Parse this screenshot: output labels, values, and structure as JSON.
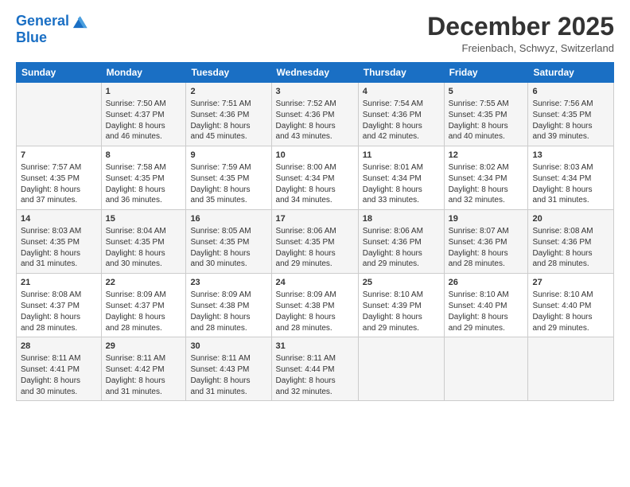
{
  "header": {
    "logo_line1": "General",
    "logo_line2": "Blue",
    "month_title": "December 2025",
    "subtitle": "Freienbach, Schwyz, Switzerland"
  },
  "weekdays": [
    "Sunday",
    "Monday",
    "Tuesday",
    "Wednesday",
    "Thursday",
    "Friday",
    "Saturday"
  ],
  "weeks": [
    [
      {
        "day": "",
        "info": ""
      },
      {
        "day": "1",
        "info": "Sunrise: 7:50 AM\nSunset: 4:37 PM\nDaylight: 8 hours\nand 46 minutes."
      },
      {
        "day": "2",
        "info": "Sunrise: 7:51 AM\nSunset: 4:36 PM\nDaylight: 8 hours\nand 45 minutes."
      },
      {
        "day": "3",
        "info": "Sunrise: 7:52 AM\nSunset: 4:36 PM\nDaylight: 8 hours\nand 43 minutes."
      },
      {
        "day": "4",
        "info": "Sunrise: 7:54 AM\nSunset: 4:36 PM\nDaylight: 8 hours\nand 42 minutes."
      },
      {
        "day": "5",
        "info": "Sunrise: 7:55 AM\nSunset: 4:35 PM\nDaylight: 8 hours\nand 40 minutes."
      },
      {
        "day": "6",
        "info": "Sunrise: 7:56 AM\nSunset: 4:35 PM\nDaylight: 8 hours\nand 39 minutes."
      }
    ],
    [
      {
        "day": "7",
        "info": "Sunrise: 7:57 AM\nSunset: 4:35 PM\nDaylight: 8 hours\nand 37 minutes."
      },
      {
        "day": "8",
        "info": "Sunrise: 7:58 AM\nSunset: 4:35 PM\nDaylight: 8 hours\nand 36 minutes."
      },
      {
        "day": "9",
        "info": "Sunrise: 7:59 AM\nSunset: 4:35 PM\nDaylight: 8 hours\nand 35 minutes."
      },
      {
        "day": "10",
        "info": "Sunrise: 8:00 AM\nSunset: 4:34 PM\nDaylight: 8 hours\nand 34 minutes."
      },
      {
        "day": "11",
        "info": "Sunrise: 8:01 AM\nSunset: 4:34 PM\nDaylight: 8 hours\nand 33 minutes."
      },
      {
        "day": "12",
        "info": "Sunrise: 8:02 AM\nSunset: 4:34 PM\nDaylight: 8 hours\nand 32 minutes."
      },
      {
        "day": "13",
        "info": "Sunrise: 8:03 AM\nSunset: 4:34 PM\nDaylight: 8 hours\nand 31 minutes."
      }
    ],
    [
      {
        "day": "14",
        "info": "Sunrise: 8:03 AM\nSunset: 4:35 PM\nDaylight: 8 hours\nand 31 minutes."
      },
      {
        "day": "15",
        "info": "Sunrise: 8:04 AM\nSunset: 4:35 PM\nDaylight: 8 hours\nand 30 minutes."
      },
      {
        "day": "16",
        "info": "Sunrise: 8:05 AM\nSunset: 4:35 PM\nDaylight: 8 hours\nand 30 minutes."
      },
      {
        "day": "17",
        "info": "Sunrise: 8:06 AM\nSunset: 4:35 PM\nDaylight: 8 hours\nand 29 minutes."
      },
      {
        "day": "18",
        "info": "Sunrise: 8:06 AM\nSunset: 4:36 PM\nDaylight: 8 hours\nand 29 minutes."
      },
      {
        "day": "19",
        "info": "Sunrise: 8:07 AM\nSunset: 4:36 PM\nDaylight: 8 hours\nand 28 minutes."
      },
      {
        "day": "20",
        "info": "Sunrise: 8:08 AM\nSunset: 4:36 PM\nDaylight: 8 hours\nand 28 minutes."
      }
    ],
    [
      {
        "day": "21",
        "info": "Sunrise: 8:08 AM\nSunset: 4:37 PM\nDaylight: 8 hours\nand 28 minutes."
      },
      {
        "day": "22",
        "info": "Sunrise: 8:09 AM\nSunset: 4:37 PM\nDaylight: 8 hours\nand 28 minutes."
      },
      {
        "day": "23",
        "info": "Sunrise: 8:09 AM\nSunset: 4:38 PM\nDaylight: 8 hours\nand 28 minutes."
      },
      {
        "day": "24",
        "info": "Sunrise: 8:09 AM\nSunset: 4:38 PM\nDaylight: 8 hours\nand 28 minutes."
      },
      {
        "day": "25",
        "info": "Sunrise: 8:10 AM\nSunset: 4:39 PM\nDaylight: 8 hours\nand 29 minutes."
      },
      {
        "day": "26",
        "info": "Sunrise: 8:10 AM\nSunset: 4:40 PM\nDaylight: 8 hours\nand 29 minutes."
      },
      {
        "day": "27",
        "info": "Sunrise: 8:10 AM\nSunset: 4:40 PM\nDaylight: 8 hours\nand 29 minutes."
      }
    ],
    [
      {
        "day": "28",
        "info": "Sunrise: 8:11 AM\nSunset: 4:41 PM\nDaylight: 8 hours\nand 30 minutes."
      },
      {
        "day": "29",
        "info": "Sunrise: 8:11 AM\nSunset: 4:42 PM\nDaylight: 8 hours\nand 31 minutes."
      },
      {
        "day": "30",
        "info": "Sunrise: 8:11 AM\nSunset: 4:43 PM\nDaylight: 8 hours\nand 31 minutes."
      },
      {
        "day": "31",
        "info": "Sunrise: 8:11 AM\nSunset: 4:44 PM\nDaylight: 8 hours\nand 32 minutes."
      },
      {
        "day": "",
        "info": ""
      },
      {
        "day": "",
        "info": ""
      },
      {
        "day": "",
        "info": ""
      }
    ]
  ]
}
